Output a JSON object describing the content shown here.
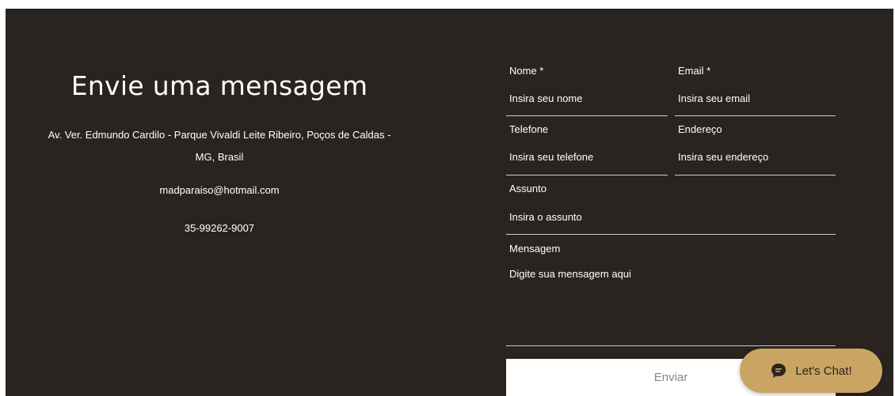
{
  "contact": {
    "title": "Envie uma mensagem",
    "address": "Av. Ver. Edmundo Cardilo - Parque Vivaldi Leite Ribeiro, Poços de Caldas - MG, Brasil",
    "email": "madparaiso@hotmail.com",
    "phone": "35-99262-9007"
  },
  "form": {
    "name": {
      "label": "Nome *",
      "placeholder": "Insira seu nome"
    },
    "email": {
      "label": "Email *",
      "placeholder": "Insira seu email"
    },
    "phone": {
      "label": "Telefone",
      "placeholder": "Insira seu telefone"
    },
    "address": {
      "label": "Endereço",
      "placeholder": "Insira seu endereço"
    },
    "subject": {
      "label": "Assunto",
      "placeholder": "Insira o assunto"
    },
    "message": {
      "label": "Mensagem",
      "placeholder": "Digite sua mensagem aqui"
    },
    "submit_label": "Enviar"
  },
  "chat": {
    "label": "Let's Chat!",
    "icon": "chat-bubble-icon"
  },
  "colors": {
    "background": "#2a2420",
    "accent": "#c9a463"
  }
}
